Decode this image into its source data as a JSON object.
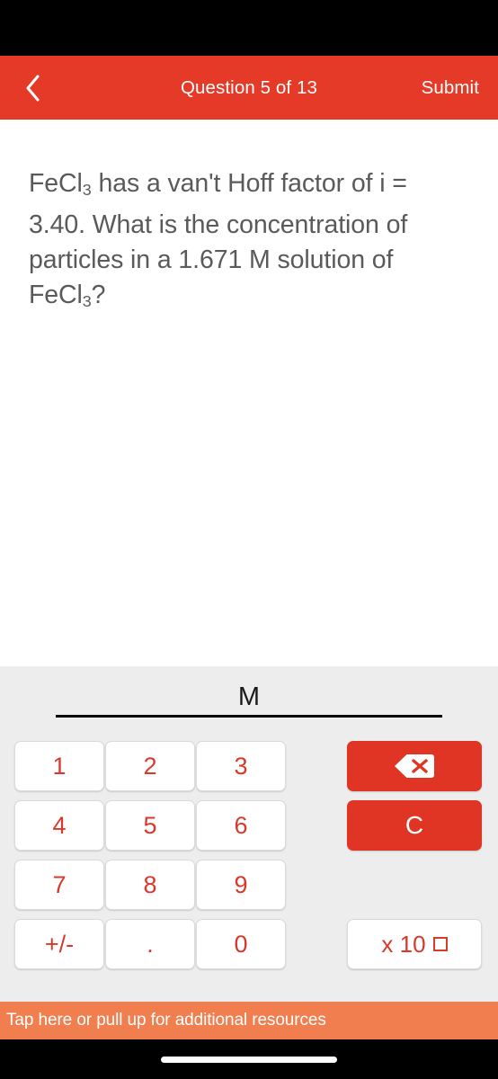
{
  "header": {
    "back_icon": "chevron-left-icon",
    "title": "Question 5 of 13",
    "submit_label": "Submit",
    "background_color": "#E53A28",
    "text_color": "#FFFFFF"
  },
  "question": {
    "text_plain": "FeCl3 has a van't Hoff factor of i = 3.40. What is the concentration of particles in a 1.671 M solution of FeCl3?",
    "parts": {
      "compound": "FeCl",
      "sub3": "3",
      "segment1": " has a van't Hoff factor of i = 3.40. What is the concentration of particles in a 1.671 M solution of ",
      "compound2": "FeCl",
      "sub3b": "3",
      "tail": "?"
    },
    "van_t_hoff_factor": "3.40",
    "concentration": "1.671 M",
    "text_color": "#5A5A5A"
  },
  "answer": {
    "value": "",
    "placeholder": "",
    "unit": "M",
    "underline_color": "#000000"
  },
  "keypad": {
    "background_color": "#EDEDED",
    "key_text_color": "#D9392A",
    "keys": [
      {
        "label": "1",
        "name": "key-1"
      },
      {
        "label": "2",
        "name": "key-2"
      },
      {
        "label": "3",
        "name": "key-3"
      },
      {
        "label": "4",
        "name": "key-4"
      },
      {
        "label": "5",
        "name": "key-5"
      },
      {
        "label": "6",
        "name": "key-6"
      },
      {
        "label": "7",
        "name": "key-7"
      },
      {
        "label": "8",
        "name": "key-8"
      },
      {
        "label": "9",
        "name": "key-9"
      },
      {
        "label": "+/-",
        "name": "key-plus-minus"
      },
      {
        "label": ".",
        "name": "key-decimal"
      },
      {
        "label": "0",
        "name": "key-0"
      }
    ],
    "actions": {
      "backspace_icon": "backspace-delete-icon",
      "clear_label": "C",
      "exponent_label": "x 10",
      "exponent_box": "",
      "action_color": "#E03524"
    }
  },
  "banner": {
    "text": "Tap here or pull up for additional resources",
    "background_color": "#F07E4E",
    "text_color": "#FFFFFF"
  }
}
